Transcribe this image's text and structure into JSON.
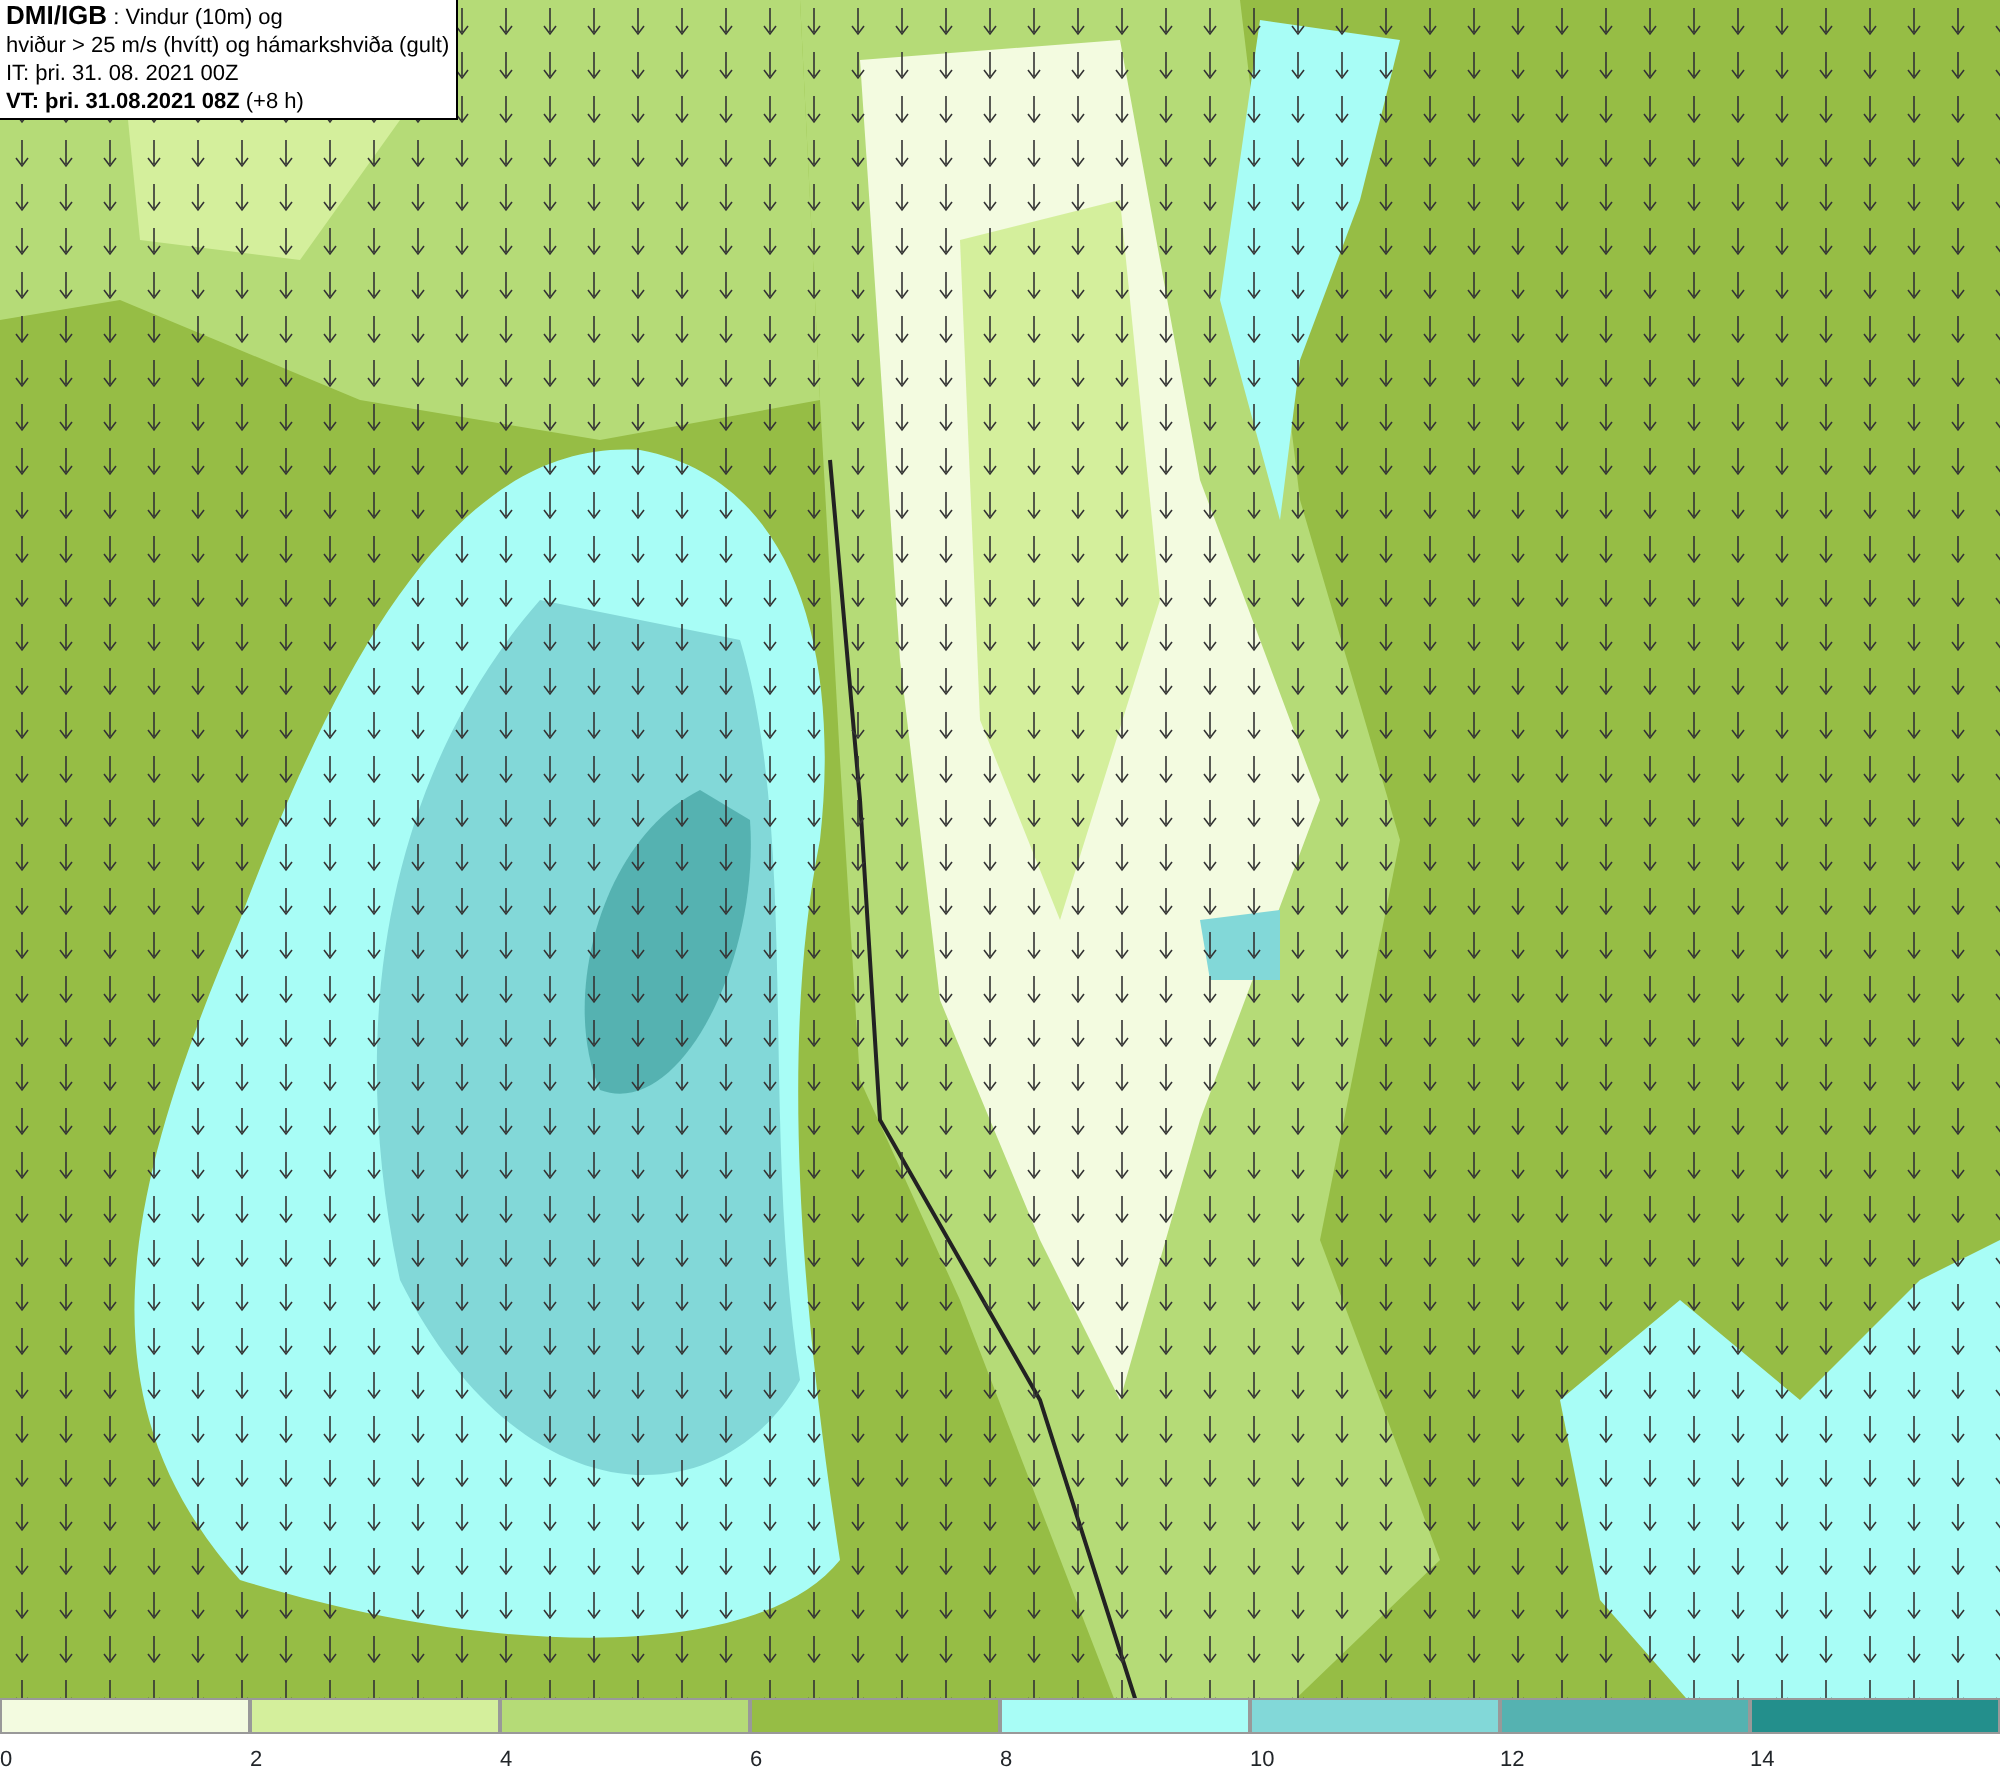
{
  "header": {
    "lines": [
      "**DMI/IGB** : Vindur (10m) og",
      "hviður > 25 m/s (hvítt) og hámarkshviða (gult)",
      "IT: þri. 31. 08. 2021 00Z",
      "**VT: þri. 31.08.2021 08Z** (+8 h)"
    ]
  },
  "legend": {
    "bins": [
      {
        "color": "#f3fbe0",
        "label": "0"
      },
      {
        "color": "#d4ef9c",
        "label": "2"
      },
      {
        "color": "#b5db77",
        "label": "4"
      },
      {
        "color": "#96bd45",
        "label": "6"
      },
      {
        "color": "#a8fdf6",
        "label": "8"
      },
      {
        "color": "#82d8d8",
        "label": "10"
      },
      {
        "color": "#55b2b1",
        "label": "12"
      },
      {
        "color": "#238f8c",
        "label": "14"
      }
    ]
  }
}
